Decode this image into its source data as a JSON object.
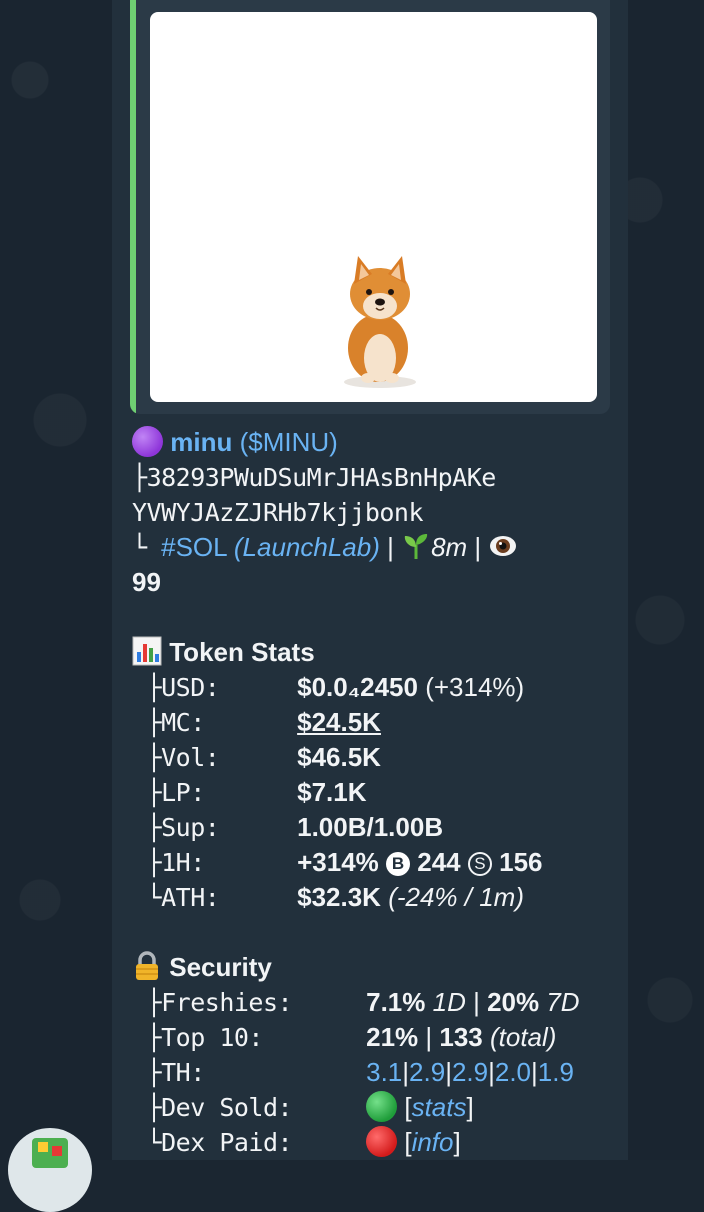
{
  "token": {
    "name": "minu",
    "ticker": "($MINU)",
    "ca_line1": "38293PWuDSuMrJHAsBnHpAKe",
    "ca_line2": "YVWYJAzZJRHb7kjjbonk",
    "chain": "#SOL",
    "platform": "(LaunchLab)",
    "age": "8m",
    "views": "99"
  },
  "token_stats": {
    "title": "Token Stats",
    "rows": [
      {
        "label": "USD:",
        "value": "$0.0₄2450",
        "extra": "(+314%)"
      },
      {
        "label": "MC:",
        "value": "$24.5K"
      },
      {
        "label": "Vol:",
        "value": "$46.5K"
      },
      {
        "label": "LP:",
        "value": "$7.1K"
      },
      {
        "label": "Sup:",
        "value": "1.00B/1.00B"
      },
      {
        "label": "1H:",
        "value": "+314%",
        "buys": "244",
        "sells": "156"
      },
      {
        "label": "ATH:",
        "value": "$32.3K",
        "extra": "(-24% / 1m)"
      }
    ]
  },
  "security": {
    "title": "Security",
    "freshies_label": "Freshies:",
    "freshies_1d": "7.1%",
    "freshies_1d_tag": "1D",
    "freshies_7d": "20%",
    "freshies_7d_tag": "7D",
    "top10_label": "Top 10:",
    "top10_pct": "21%",
    "top10_total": "133",
    "top10_total_tag": "(total)",
    "th_label": "TH:",
    "th_values": [
      "3.1",
      "2.9",
      "2.9",
      "2.0",
      "1.9"
    ],
    "dev_sold_label": "Dev Sold:",
    "dev_sold_link": "stats",
    "dex_paid_label": "Dex Paid:",
    "dex_paid_link": "info"
  },
  "colors": {
    "link": "#6ab3f3",
    "accent_bar": "#6fcf72",
    "bubble": "#22303c",
    "background": "#1a2530"
  },
  "icons": {
    "token_dot": "purple-circle-icon",
    "chain_sprout": "seedling-icon",
    "views": "eye-icon",
    "stats": "bar-chart-icon",
    "security": "lock-icon",
    "dev_sold": "green-circle-icon",
    "dex_paid": "red-circle-icon",
    "buys": "b-circle-icon",
    "sells": "s-circle-icon"
  }
}
